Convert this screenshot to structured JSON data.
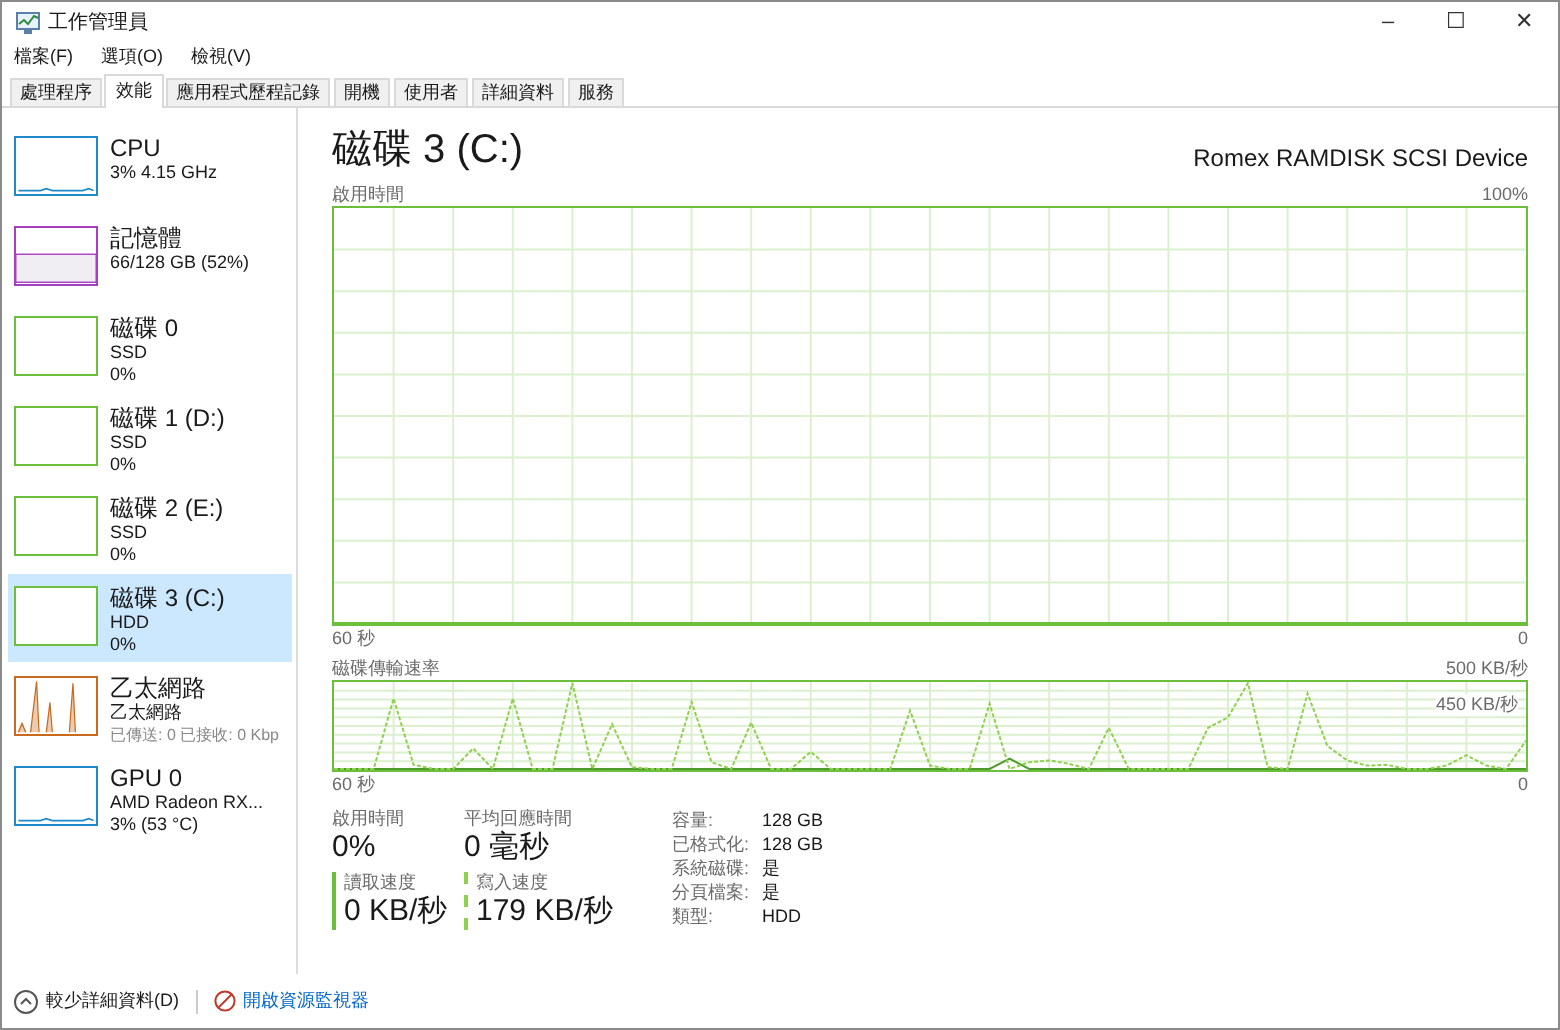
{
  "window": {
    "title": "工作管理員",
    "controls": [
      "–",
      "☐",
      "✕"
    ]
  },
  "menu": [
    "檔案(F)",
    "選項(O)",
    "檢視(V)"
  ],
  "tabs": [
    {
      "label": "處理程序",
      "selected": false
    },
    {
      "label": "效能",
      "selected": true
    },
    {
      "label": "應用程式歷程記錄",
      "selected": false
    },
    {
      "label": "開機",
      "selected": false
    },
    {
      "label": "使用者",
      "selected": false
    },
    {
      "label": "詳細資料",
      "selected": false
    },
    {
      "label": "服務",
      "selected": false
    }
  ],
  "sidebar": {
    "items": [
      {
        "kind": "cpu",
        "title": "CPU",
        "lines": [
          "3% 4.15 GHz"
        ],
        "color": "#1e88c8",
        "selected": false
      },
      {
        "kind": "memory",
        "title": "記憶體",
        "lines": [
          "66/128 GB (52%)"
        ],
        "color": "#a93dc1",
        "selected": false
      },
      {
        "kind": "disk",
        "title": "磁碟 0",
        "lines": [
          "SSD",
          "0%"
        ],
        "color": "#6cbf3c",
        "selected": false
      },
      {
        "kind": "disk",
        "title": "磁碟 1 (D:)",
        "lines": [
          "SSD",
          "0%"
        ],
        "color": "#6cbf3c",
        "selected": false
      },
      {
        "kind": "disk",
        "title": "磁碟 2 (E:)",
        "lines": [
          "SSD",
          "0%"
        ],
        "color": "#6cbf3c",
        "selected": false
      },
      {
        "kind": "disk",
        "title": "磁碟 3 (C:)",
        "lines": [
          "HDD",
          "0%"
        ],
        "color": "#6cbf3c",
        "selected": true
      },
      {
        "kind": "network",
        "title": "乙太網路",
        "lines": [
          "乙太網路",
          "已傳送: 0 已接收: 0 Kbp"
        ],
        "color": "#c8691e",
        "selected": false
      },
      {
        "kind": "gpu",
        "title": "GPU 0",
        "lines": [
          "AMD Radeon RX...",
          "3% (53 °C)"
        ],
        "color": "#1e88c8",
        "selected": false
      }
    ]
  },
  "main": {
    "title": "磁碟 3 (C:)",
    "device": "Romex RAMDISK SCSI Device",
    "usage_chart": {
      "kind": "usage",
      "title": "啟用時間",
      "max_label": "100%",
      "time_label": "60 秒",
      "min_label": "0"
    },
    "transfer_chart": {
      "kind": "transfer",
      "title": "磁碟傳輸速率",
      "max_label": "500 KB/秒",
      "scale_label": "450 KB/秒",
      "time_label": "60 秒",
      "min_label": "0"
    },
    "stats": [
      {
        "label": "啟用時間",
        "value": "0%",
        "kind": "plain"
      },
      {
        "label": "平均回應時間",
        "value": "0 毫秒",
        "kind": "plain"
      },
      {
        "label": "讀取速度",
        "value": "0 KB/秒",
        "kind": "solid"
      },
      {
        "label": "寫入速度",
        "value": "179 KB/秒",
        "kind": "dashed"
      }
    ],
    "properties": [
      {
        "label": "容量:",
        "value": "128 GB"
      },
      {
        "label": "已格式化:",
        "value": "128 GB"
      },
      {
        "label": "系統磁碟:",
        "value": "是"
      },
      {
        "label": "分頁檔案:",
        "value": "是"
      },
      {
        "label": "類型:",
        "value": "HDD"
      }
    ]
  },
  "footer": {
    "fewer_details": "較少詳細資料(D)",
    "resource_monitor": "開啟資源監視器"
  }
}
